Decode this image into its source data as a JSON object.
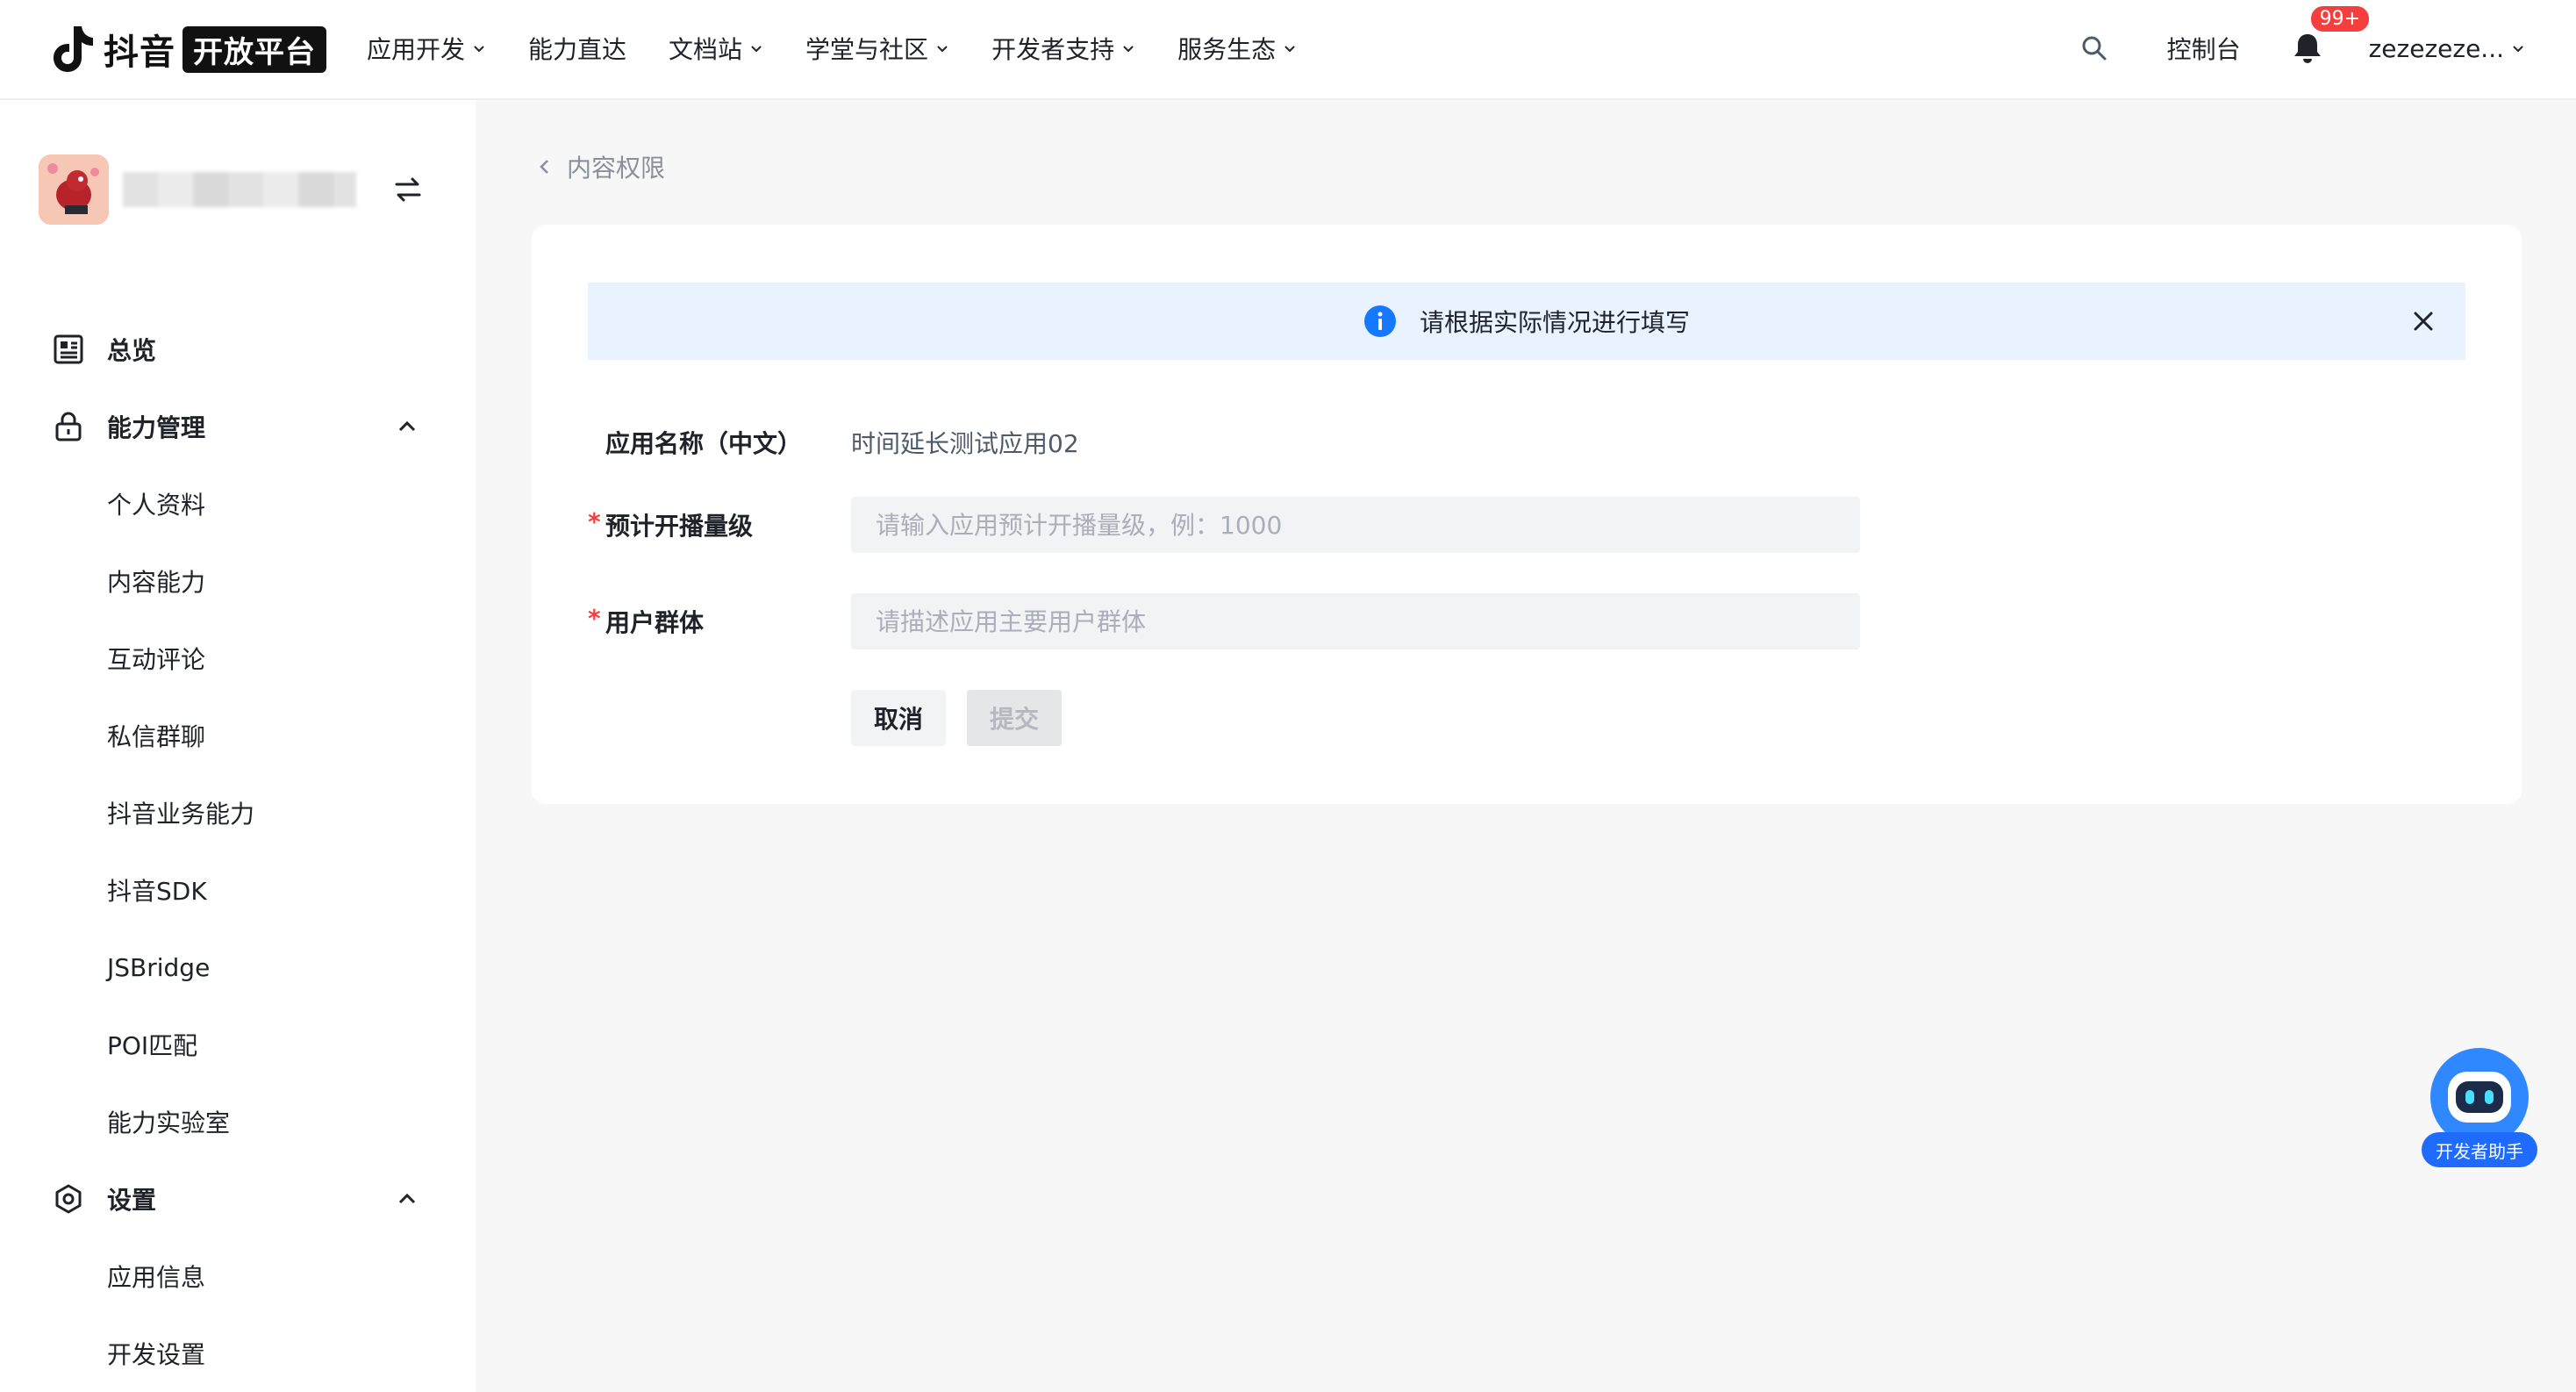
{
  "header": {
    "logo_word": "抖音",
    "logo_badge": "开放平台",
    "nav": [
      {
        "label": "应用开发",
        "dropdown": true
      },
      {
        "label": "能力直达",
        "dropdown": false
      },
      {
        "label": "文档站",
        "dropdown": true
      },
      {
        "label": "学堂与社区",
        "dropdown": true
      },
      {
        "label": "开发者支持",
        "dropdown": true
      },
      {
        "label": "服务生态",
        "dropdown": true
      }
    ],
    "console": "控制台",
    "notification_badge": "99+",
    "username": "zezezeze..."
  },
  "sidebar": {
    "groups": [
      {
        "label": "总览",
        "icon": "overview-icon"
      },
      {
        "label": "能力管理",
        "icon": "lock-icon",
        "expanded": true,
        "items": [
          "个人资料",
          "内容能力",
          "互动评论",
          "私信群聊",
          "抖音业务能力",
          "抖音SDK",
          "JSBridge",
          "POI匹配",
          "能力实验室"
        ]
      },
      {
        "label": "设置",
        "icon": "settings-icon",
        "expanded": true,
        "items": [
          "应用信息",
          "开发设置"
        ]
      }
    ]
  },
  "main": {
    "back_label": "内容权限",
    "alert_text": "请根据实际情况进行填写",
    "form": {
      "app_name_label": "应用名称（中文）",
      "app_name_value": "时间延长测试应用02",
      "scale_label": "预计开播量级",
      "scale_placeholder": "请输入应用预计开播量级，例：1000",
      "users_label": "用户群体",
      "users_placeholder": "请描述应用主要用户群体",
      "required_mark": "*",
      "cancel": "取消",
      "submit": "提交"
    }
  },
  "assistant": {
    "label": "开发者助手"
  },
  "colors": {
    "accent": "#1677ff",
    "alert_bg": "#e8f3ff",
    "required": "#f53f3f",
    "badge": "#f53f3f"
  }
}
